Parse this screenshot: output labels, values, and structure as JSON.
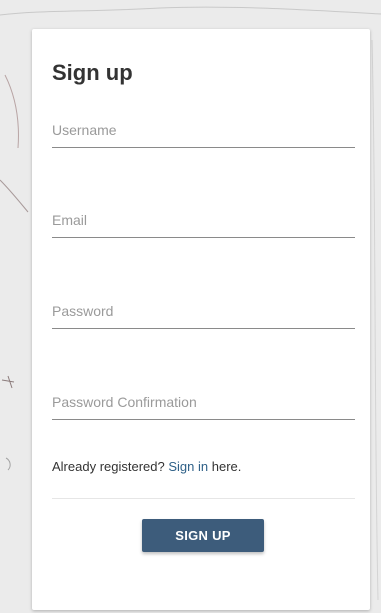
{
  "form": {
    "title": "Sign up",
    "username_placeholder": "Username",
    "email_placeholder": "Email",
    "password_placeholder": "Password",
    "password_confirmation_placeholder": "Password Confirmation",
    "already_registered_text": "Already registered?",
    "sign_in_link": "Sign in",
    "here_text": "here.",
    "submit_label": "SIGN UP"
  },
  "colors": {
    "background": "#ebebeb",
    "card": "#ffffff",
    "button": "#3d5c7b",
    "link": "#2f6188"
  }
}
